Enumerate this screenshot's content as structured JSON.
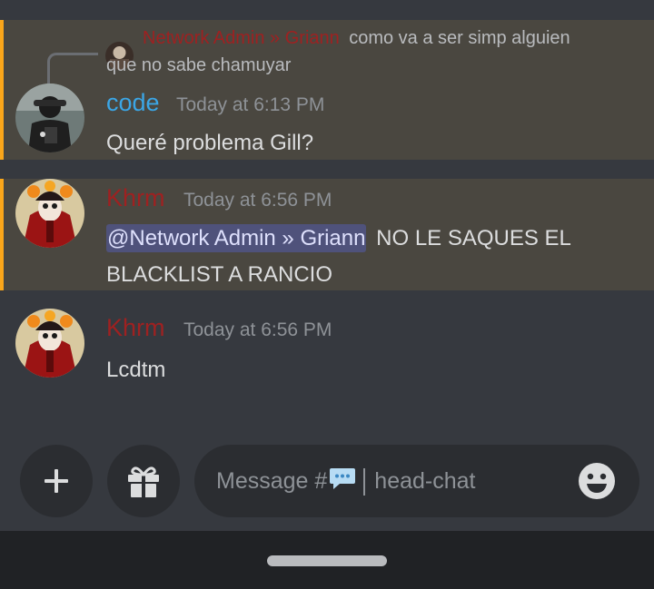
{
  "messages": [
    {
      "reply": {
        "author": "Network Admin » Griann",
        "preview_line1": "como va a ser simp alguien",
        "preview_line2": "que no sabe chamuyar"
      },
      "author": "code",
      "author_color": "#3ba6e6",
      "timestamp": "Today at 6:13 PM",
      "text": "Queré problema Gill?",
      "highlighted": true
    },
    {
      "author": "Khrm",
      "author_color": "#9e2121",
      "timestamp": "Today at 6:56 PM",
      "mention": "@Network Admin » Griann",
      "text_after_mention": "NO LE SAQUES EL",
      "text_line2": "BLACKLIST A RANCIO",
      "highlighted": true
    },
    {
      "author": "Khrm",
      "author_color": "#9e2121",
      "timestamp": "Today at 6:56 PM",
      "text": "Lcdtm",
      "highlighted": false
    }
  ],
  "composer": {
    "placeholder_prefix": "Message #",
    "channel_name": "head-chat",
    "icons": [
      "plus-icon",
      "gift-icon",
      "speech-bubble-icon",
      "emoji-icon"
    ]
  },
  "colors": {
    "background": "#36393f",
    "mention_highlight": "#4a4740",
    "mention_bar": "#faa61a",
    "mention_pill": "#4f527b"
  }
}
